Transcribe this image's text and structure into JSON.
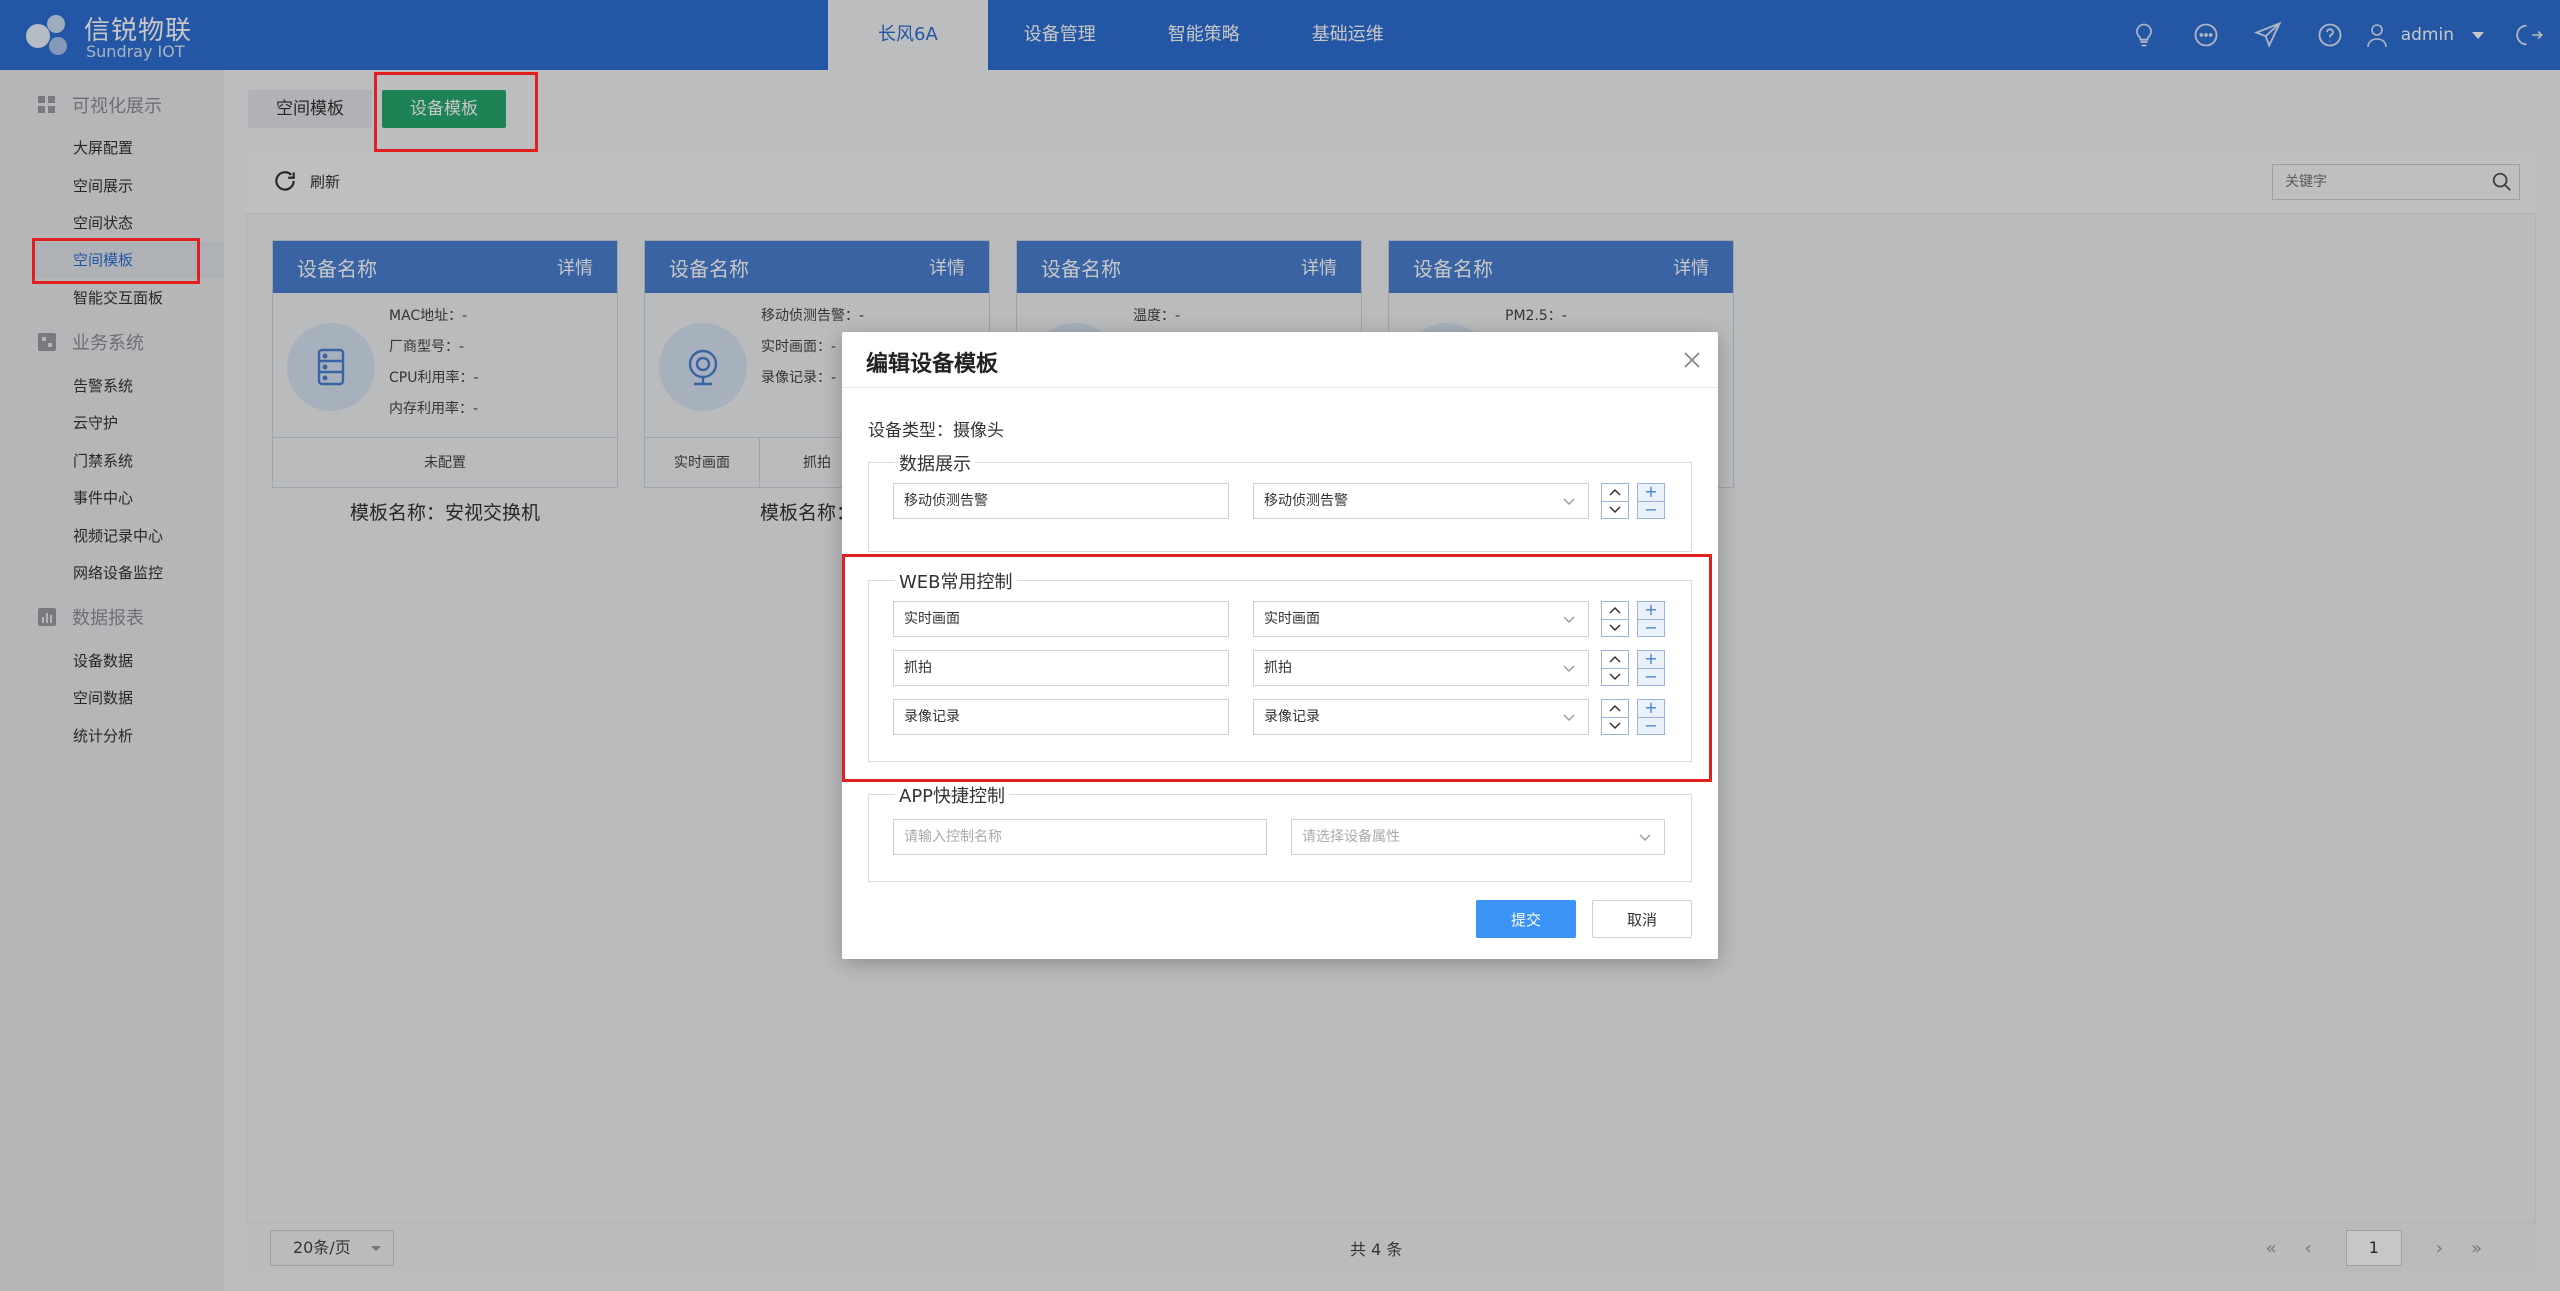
{
  "logo": {
    "cn": "信锐物联",
    "en": "Sundray IOT"
  },
  "topnav": [
    {
      "label": "长风6A",
      "active": true
    },
    {
      "label": "设备管理"
    },
    {
      "label": "智能策略"
    },
    {
      "label": "基础运维"
    }
  ],
  "header": {
    "user": "admin"
  },
  "sidebar": {
    "groups": [
      {
        "label": "可视化展示",
        "items": [
          "大屏配置",
          "空间展示",
          "空间状态",
          "空间模板",
          "智能交互面板"
        ]
      },
      {
        "label": "业务系统",
        "items": [
          "告警系统",
          "云守护",
          "门禁系统",
          "事件中心",
          "视频记录中心",
          "网络设备监控"
        ]
      },
      {
        "label": "数据报表",
        "items": [
          "设备数据",
          "空间数据",
          "统计分析"
        ]
      }
    ],
    "active_item": "空间模板"
  },
  "tabs": [
    "空间模板",
    "设备模板"
  ],
  "toolbar": {
    "refresh": "刷新",
    "search_placeholder": "关键字"
  },
  "cards": [
    {
      "head": "设备名称",
      "detail": "详情",
      "props": [
        "MAC地址：-",
        "厂商型号：-",
        "CPU利用率：-",
        "内存利用率：-"
      ],
      "foot": [
        "未配置"
      ],
      "title": "模板名称：安视交换机"
    },
    {
      "head": "设备名称",
      "detail": "详情",
      "props": [
        "移动侦测告警：-",
        "实时画面：-",
        "录像记录：-"
      ],
      "foot": [
        "实时画面",
        "抓拍",
        ""
      ],
      "title": "模板名称：摄"
    },
    {
      "head": "设备名称",
      "detail": "详情",
      "props": [
        "温度：-"
      ],
      "foot": [],
      "title": ""
    },
    {
      "head": "设备名称",
      "detail": "详情",
      "props": [
        "PM2.5：-"
      ],
      "foot": [],
      "title": ""
    }
  ],
  "footer": {
    "page_size": "20条/页",
    "total": "共 4 条",
    "page": "1"
  },
  "modal": {
    "title": "编辑设备模板",
    "device_type": "设备类型：摄像头",
    "sections": [
      {
        "legend": "数据展示",
        "rows": [
          {
            "name": "移动侦测告警",
            "attr": "移动侦测告警"
          }
        ]
      },
      {
        "legend": "WEB常用控制",
        "rows": [
          {
            "name": "实时画面",
            "attr": "实时画面"
          },
          {
            "name": "抓拍",
            "attr": "抓拍"
          },
          {
            "name": "录像记录",
            "attr": "录像记录"
          }
        ]
      },
      {
        "legend": "APP快捷控制",
        "name_placeholder": "请输入控制名称",
        "attr_placeholder": "请选择设备属性"
      }
    ],
    "submit": "提交",
    "cancel": "取消"
  },
  "colors": {
    "primary": "#2e6fd3",
    "tab_active": "#26a86d",
    "highlight": "#e02020",
    "submit": "#3b93f6"
  }
}
